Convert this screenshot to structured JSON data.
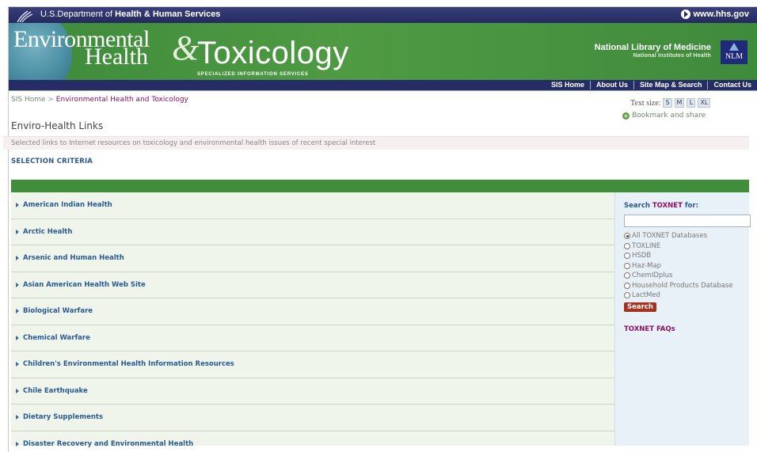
{
  "hhs": {
    "text_prefix": "U.S.Department of ",
    "text_bold": "Health & Human Services",
    "link": "www.hhs.gov"
  },
  "banner": {
    "title_line1": "Environmental",
    "title_line2": "Health",
    "title_amp": "&",
    "title_tox": "Toxicology",
    "title_sub": "SPECIALIZED INFORMATION SERVICES",
    "nlm_name": "National Library of Medicine",
    "nlm_sub": "National Institutes of Health",
    "nlm_logo": "NLM"
  },
  "topnav": [
    "SIS Home",
    "About Us",
    "Site Map & Search",
    "Contact Us"
  ],
  "breadcrumb": {
    "home": "SIS Home",
    "separator": " > ",
    "current": "Environmental Health and Toxicology"
  },
  "page_title": "Enviro-Health Links",
  "text_size": {
    "label": "Text size:",
    "options": [
      "S",
      "M",
      "L",
      "XL"
    ]
  },
  "bookmark_label": "Bookmark and share",
  "intro_text": "Selected links to Internet resources on toxicology and environmental health issues of recent special interest",
  "selection_criteria": "SELECTION CRITERIA",
  "links": [
    "American Indian Health",
    "Arctic Health",
    "Arsenic and Human Health",
    "Asian American Health Web Site",
    "Biological Warfare",
    "Chemical Warfare",
    "Children's Environmental Health Information Resources",
    "Chile Earthquake",
    "Dietary Supplements",
    "Disaster Recovery and Environmental Health"
  ],
  "sidebar": {
    "search_prefix": "Search ",
    "search_brand": "TOXNET",
    "search_suffix": " for:",
    "search_value": "",
    "options": [
      "All TOXNET Databases",
      "TOXLINE",
      "HSDB",
      "Haz-Map",
      "ChemIDplus",
      "Household Products Database",
      "LactMed"
    ],
    "selected_option": "All TOXNET Databases",
    "search_button": "Search",
    "faq_link": "TOXNET FAQs"
  }
}
